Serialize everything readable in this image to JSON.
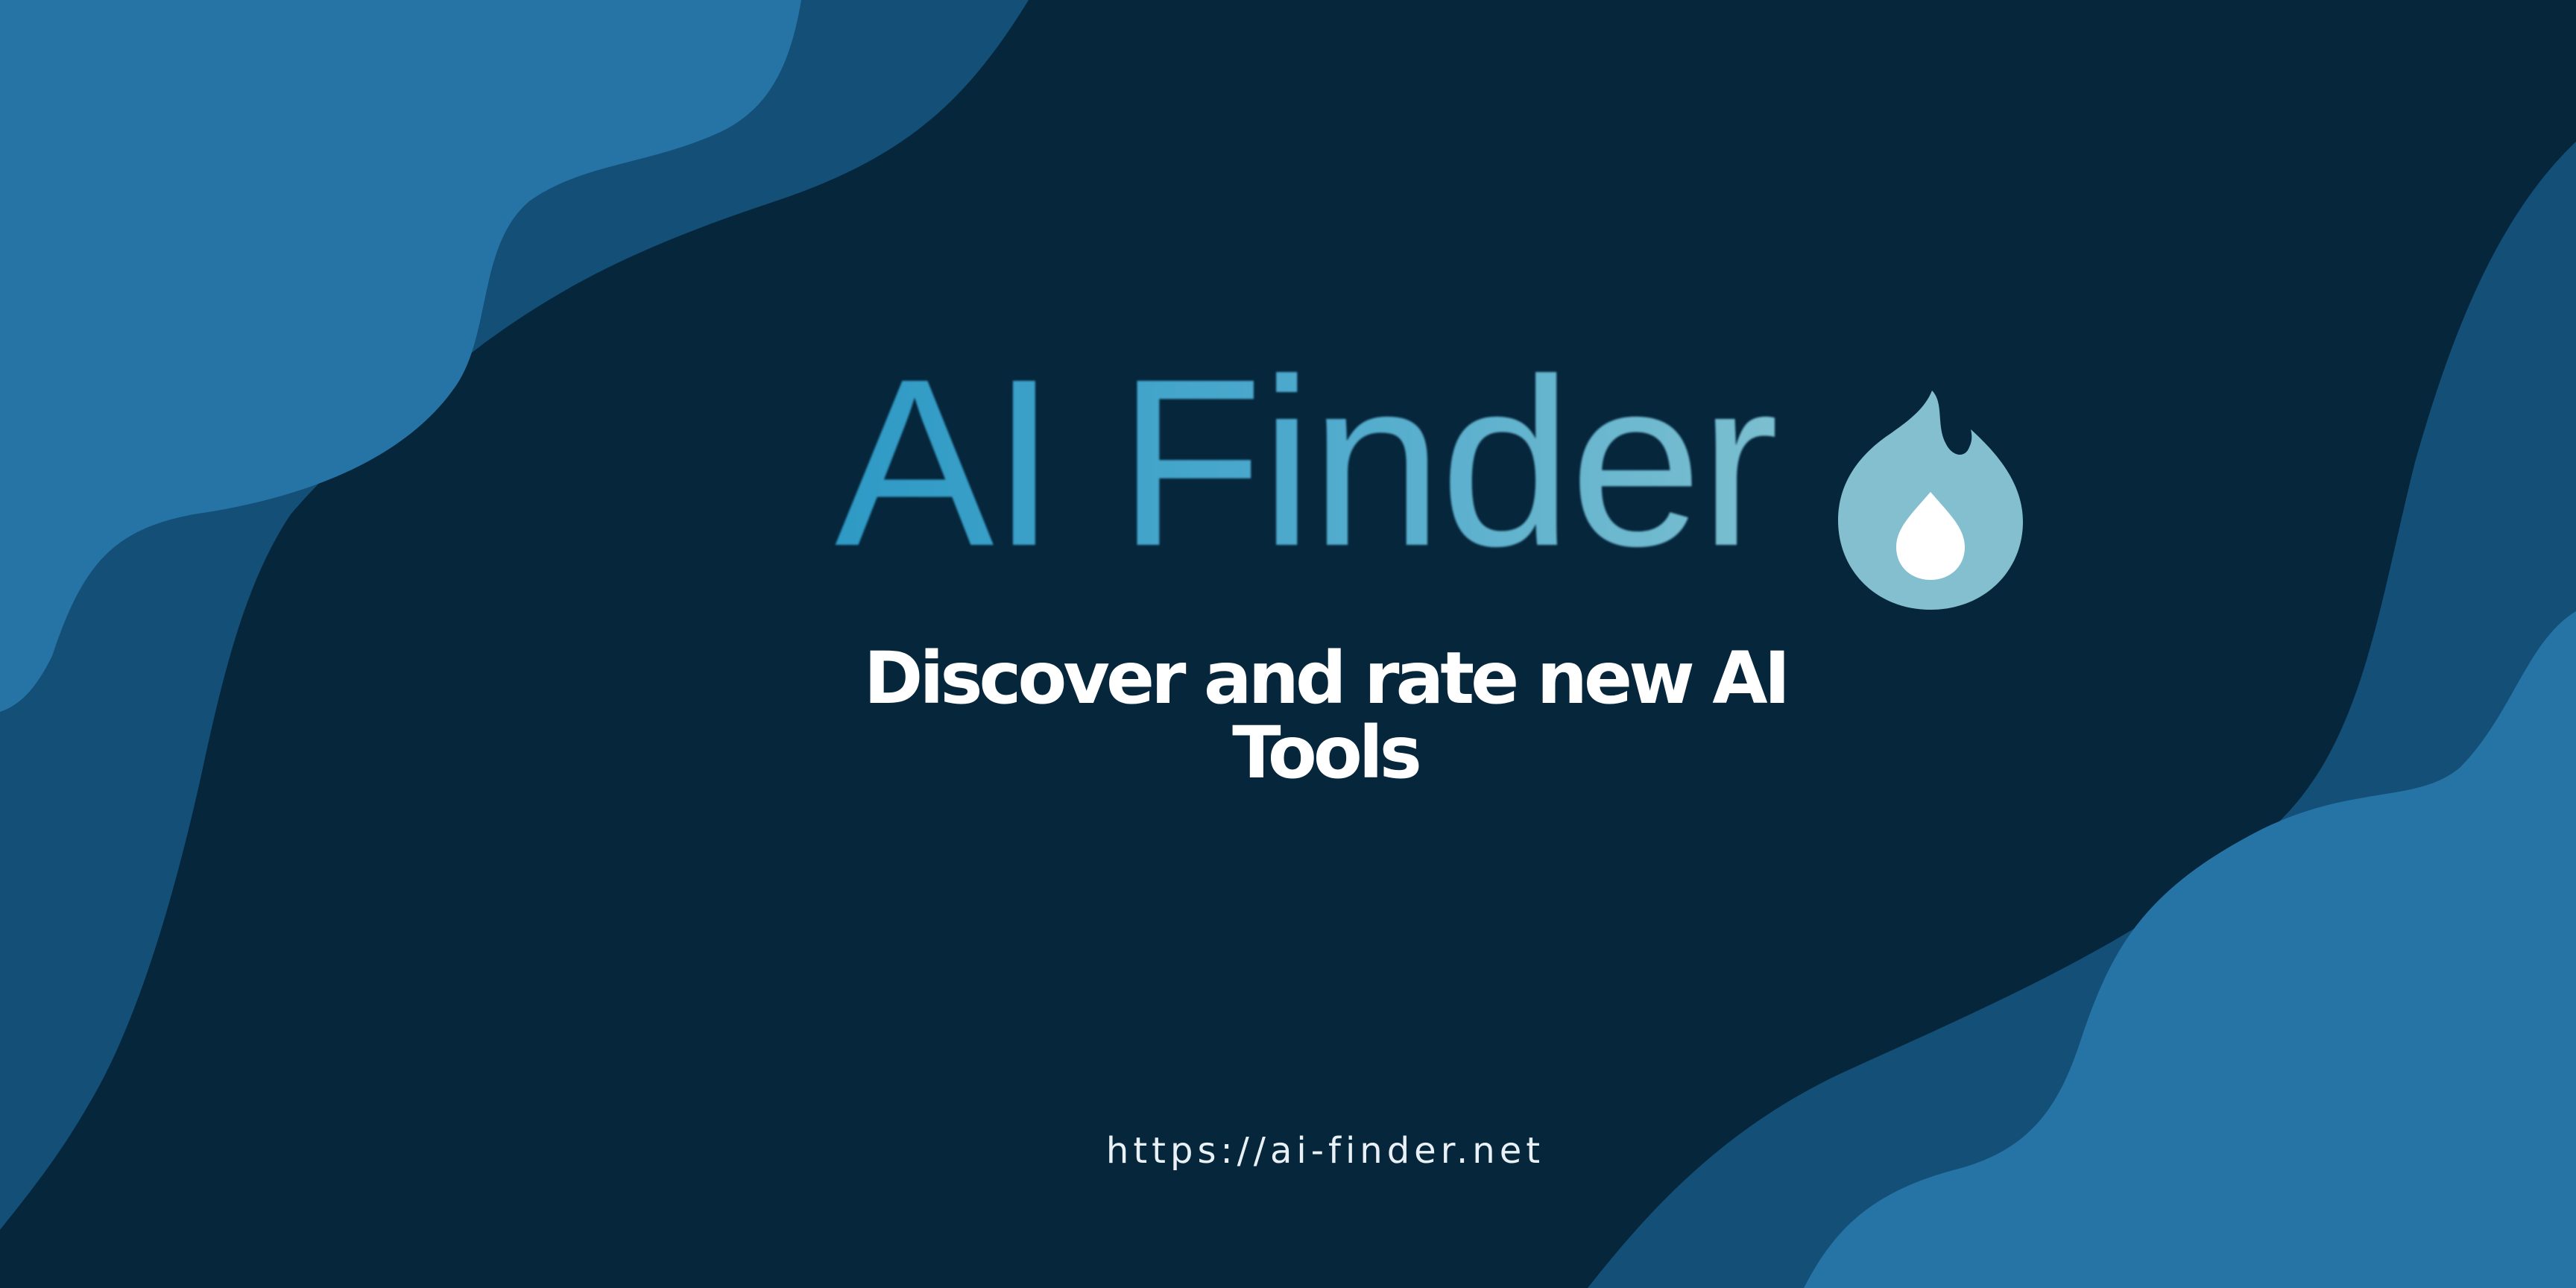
{
  "brand": {
    "name": "AI Finder",
    "icon": "flame-icon"
  },
  "tagline": {
    "text": "Discover and rate new AI Tools"
  },
  "footer": {
    "url": "https://ai-finder.net"
  },
  "colors": {
    "background": "#06263c",
    "wave_light": "#2674a6",
    "wave_mid": "#134f76",
    "brand_text": "#3aa3c8",
    "flame": "#84bfcf",
    "text": "#ffffff"
  }
}
